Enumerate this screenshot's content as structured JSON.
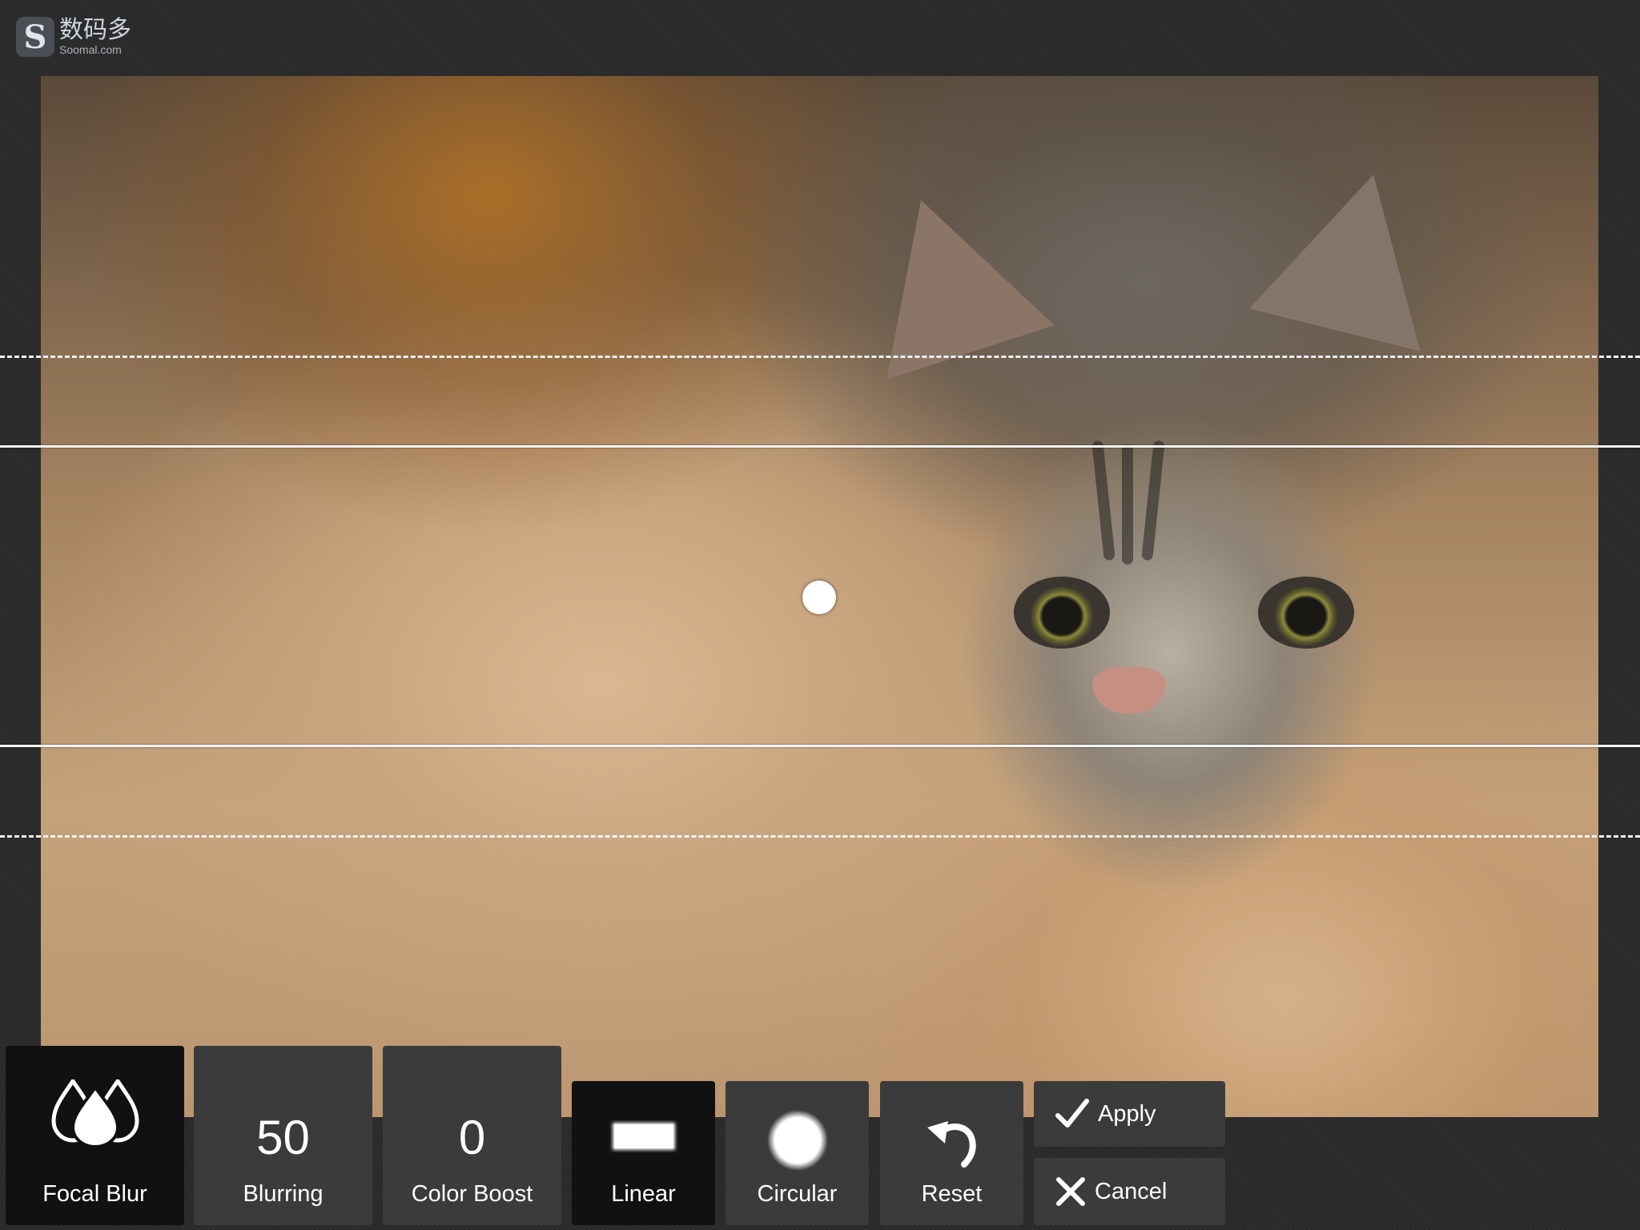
{
  "watermark": {
    "glyph": "S",
    "cn": "数码多",
    "en": "Soomal.com"
  },
  "focal_blur": {
    "label": "Focal Blur",
    "icon": "drops-icon"
  },
  "blurring": {
    "value": "50",
    "label": "Blurring"
  },
  "color_boost": {
    "value": "0",
    "label": "Color Boost"
  },
  "shapes": {
    "linear": {
      "label": "Linear",
      "icon": "linear-shape-icon",
      "selected": true
    },
    "circular": {
      "label": "Circular",
      "icon": "circular-shape-icon",
      "selected": false
    }
  },
  "reset": {
    "label": "Reset",
    "icon": "undo-arrow-icon"
  },
  "apply": {
    "label": "Apply",
    "icon": "checkmark-icon"
  },
  "cancel": {
    "label": "Cancel",
    "icon": "x-icon"
  },
  "colors": {
    "background": "#2a2a2a",
    "tile": "#3b3b3b",
    "tile_selected": "#111111",
    "text": "#ffffff"
  }
}
